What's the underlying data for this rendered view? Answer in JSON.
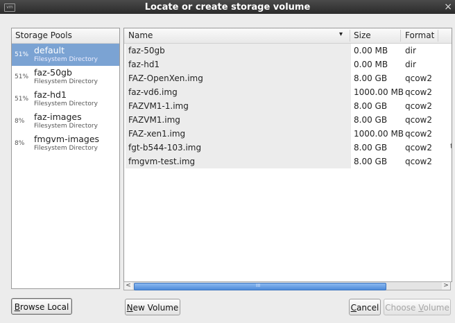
{
  "window": {
    "title": "Locate or create storage volume",
    "app_icon": "vm",
    "close_glyph": "×"
  },
  "pools": {
    "header": "Storage Pools",
    "items": [
      {
        "pct": "51%",
        "name": "default",
        "type": "Filesystem Directory",
        "selected": true
      },
      {
        "pct": "51%",
        "name": "faz-50gb",
        "type": "Filesystem Directory",
        "selected": false
      },
      {
        "pct": "51%",
        "name": "faz-hd1",
        "type": "Filesystem Directory",
        "selected": false
      },
      {
        "pct": "8%",
        "name": "faz-images",
        "type": "Filesystem Directory",
        "selected": false
      },
      {
        "pct": "8%",
        "name": "fmgvm-images",
        "type": "Filesystem Directory",
        "selected": false
      }
    ]
  },
  "volumes": {
    "columns": {
      "name": "Name",
      "size": "Size",
      "format": "Format"
    },
    "sort_icon": "▾",
    "rows": [
      {
        "name": "faz-50gb",
        "size": "0.00 MB",
        "format": "dir",
        "trail": ""
      },
      {
        "name": "faz-hd1",
        "size": "0.00 MB",
        "format": "dir",
        "trail": ""
      },
      {
        "name": "FAZ-OpenXen.img",
        "size": "8.00 GB",
        "format": "qcow2",
        "trail": ""
      },
      {
        "name": "faz-vd6.img",
        "size": "1000.00 MB",
        "format": "qcow2",
        "trail": ""
      },
      {
        "name": "FAZVM1-1.img",
        "size": "8.00 GB",
        "format": "qcow2",
        "trail": ""
      },
      {
        "name": "FAZVM1.img",
        "size": "8.00 GB",
        "format": "qcow2",
        "trail": ""
      },
      {
        "name": "FAZ-xen1.img",
        "size": "1000.00 MB",
        "format": "qcow2",
        "trail": ""
      },
      {
        "name": "fgt-b544-103.img",
        "size": "8.00 GB",
        "format": "qcow2",
        "trail": "t"
      },
      {
        "name": "fmgvm-test.img",
        "size": "8.00 GB",
        "format": "qcow2",
        "trail": ""
      }
    ]
  },
  "scrollbar": {
    "left_arrow": "<",
    "right_arrow": ">",
    "grip": "III"
  },
  "buttons": {
    "browse_local": {
      "accel": "B",
      "rest": "rowse Local"
    },
    "new_volume": {
      "accel": "N",
      "rest": "ew Volume"
    },
    "cancel": {
      "accel": "C",
      "rest": "ancel"
    },
    "choose_volume": {
      "pre": "Choose ",
      "accel": "V",
      "rest": "olume"
    }
  }
}
